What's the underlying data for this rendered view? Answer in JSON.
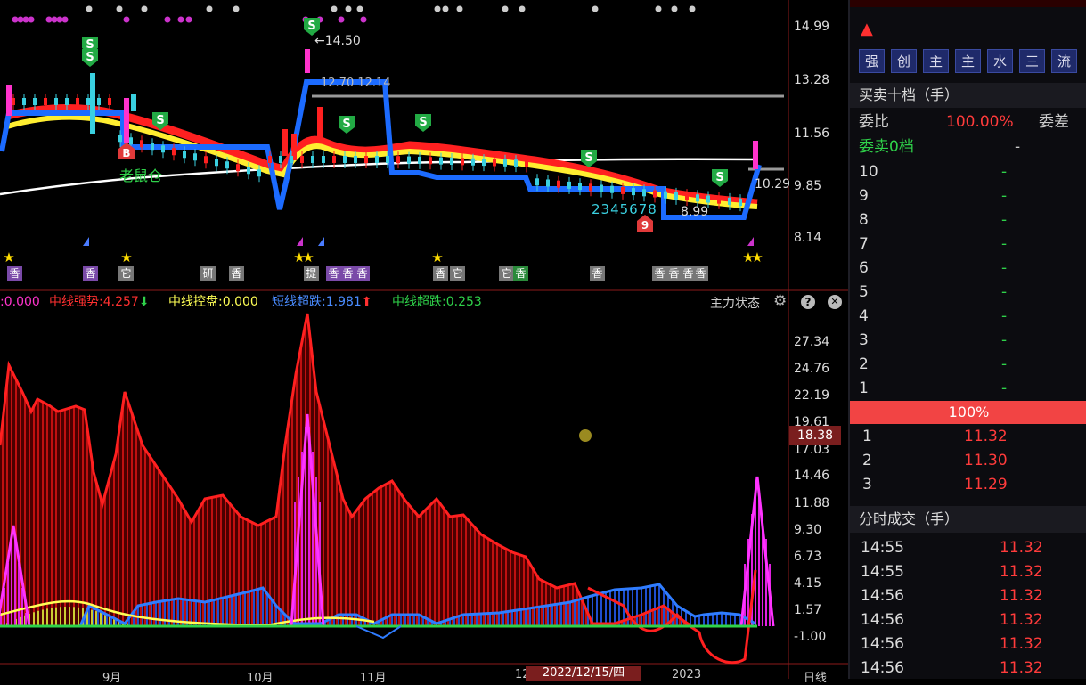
{
  "price_axis": [
    "14.99",
    "13.28",
    "11.56",
    "9.85",
    "8.14"
  ],
  "indicator_axis": [
    "27.34",
    "24.76",
    "22.19",
    "19.61",
    "17.03",
    "14.46",
    "11.88",
    "9.30",
    "6.73",
    "4.15",
    "1.57",
    "-1.00"
  ],
  "cursor_value": "18.38",
  "x_axis": [
    "9月",
    "10月",
    "11月",
    "12",
    "2023",
    "日线"
  ],
  "cursor_date": "2022/12/15/四",
  "annotations": {
    "high_price": "←14.50",
    "level_line": "12.70 12.14",
    "last_price": "10.29",
    "low_price": "8.99",
    "laoshucang": "老鼠仓",
    "wave_count": "2345678"
  },
  "bottom_badges": [
    "香",
    "香",
    "它",
    "研",
    "香",
    "提",
    "香",
    "香",
    "香",
    "香",
    "它",
    "它",
    "香",
    "香",
    "香",
    "香",
    "香",
    "香"
  ],
  "indicator": {
    "items": [
      {
        "label": ":0.000",
        "color": "#ff33cc"
      },
      {
        "label": "中线强势:4.257",
        "color": "#ff3030",
        "arrow": "⬇",
        "arrow_color": "#2fd24a"
      },
      {
        "label": "中线控盘:0.000",
        "color": "#ffff55"
      },
      {
        "label": "短线超跌:1.981",
        "color": "#4a8cff",
        "arrow": "⬆",
        "arrow_color": "#ff3030"
      },
      {
        "label": "中线超跌:0.253",
        "color": "#2fd24a"
      }
    ],
    "title": "主力状态",
    "gear_icon": "⚙",
    "help_icon": "?",
    "close_icon": "✕"
  },
  "right_panel": {
    "warn_icon": "▲",
    "tag_buttons": [
      "强",
      "创",
      "主",
      "主",
      "水",
      "三",
      "流"
    ],
    "book_title": "买卖十档（手）",
    "webi_label": "委比",
    "webi_value": "100.00%",
    "weicha_label": "委差",
    "ask0_label": "委卖0档",
    "ask0_value": "-",
    "asks": [
      {
        "level": "10",
        "value": "-"
      },
      {
        "level": "9",
        "value": "-"
      },
      {
        "level": "8",
        "value": "-"
      },
      {
        "level": "7",
        "value": "-"
      },
      {
        "level": "6",
        "value": "-"
      },
      {
        "level": "5",
        "value": "-"
      },
      {
        "level": "4",
        "value": "-"
      },
      {
        "level": "3",
        "value": "-"
      },
      {
        "level": "2",
        "value": "-"
      },
      {
        "level": "1",
        "value": "-"
      }
    ],
    "ratio": "100%",
    "bids": [
      {
        "level": "1",
        "price": "11.32"
      },
      {
        "level": "2",
        "price": "11.30"
      },
      {
        "level": "3",
        "price": "11.29"
      }
    ],
    "trades_title": "分时成交（手）",
    "trades": [
      {
        "time": "14:55",
        "price": "11.32"
      },
      {
        "time": "14:55",
        "price": "11.32"
      },
      {
        "time": "14:56",
        "price": "11.32"
      },
      {
        "time": "14:56",
        "price": "11.32"
      },
      {
        "time": "14:56",
        "price": "11.32"
      },
      {
        "time": "14:56",
        "price": "11.32"
      }
    ]
  }
}
